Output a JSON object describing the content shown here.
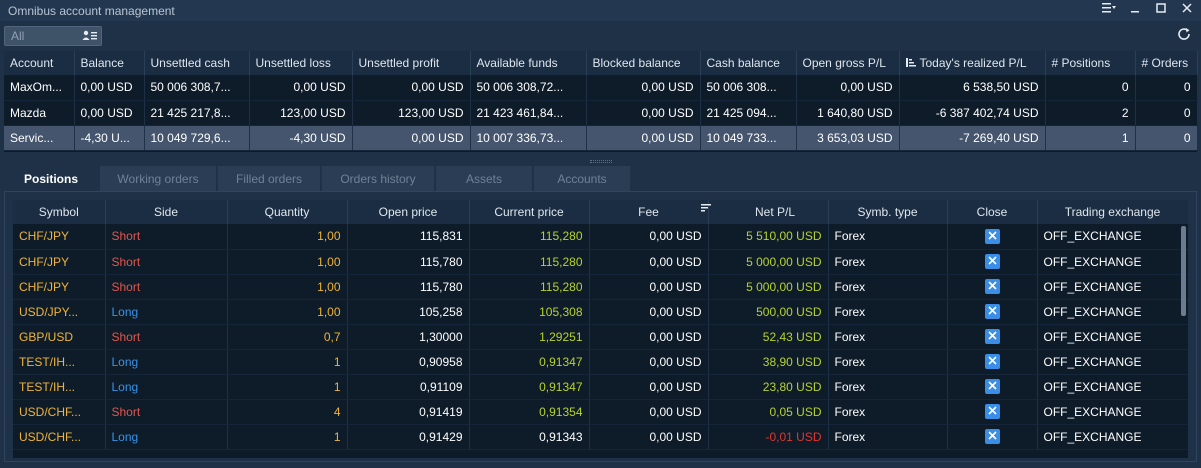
{
  "window": {
    "title": "Omnibus account management"
  },
  "toolbar": {
    "filter_placeholder": "All"
  },
  "accounts": {
    "columns": [
      "Account",
      "Balance",
      "Unsettled cash",
      "Unsettled loss",
      "Unsettled profit",
      "Available funds",
      "Blocked balance",
      "Cash balance",
      "Open gross P/L",
      "Today's realized P/L",
      "# Positions",
      "# Orders"
    ],
    "rows": [
      [
        "MaxOm...",
        "0,00 USD",
        "50 006 308,7...",
        "0,00 USD",
        "0,00 USD",
        "50 006 308,72...",
        "0,00 USD",
        "50 006 308...",
        "0,00 USD",
        "6 538,50 USD",
        "0",
        "0"
      ],
      [
        "Mazda",
        "0,00 USD",
        "21 425 217,8...",
        "123,00 USD",
        "123,00 USD",
        "21 423 461,84...",
        "0,00 USD",
        "21 425 094...",
        "1 640,80 USD",
        "-6 387 402,74 USD",
        "2",
        "0"
      ],
      [
        "Servic...",
        "-4,30 U...",
        "10 049 729,6...",
        "-4,30 USD",
        "0,00 USD",
        "10 007 336,73...",
        "0,00 USD",
        "10 049 733...",
        "3 653,03 USD",
        "-7 269,40 USD",
        "1",
        "0"
      ]
    ]
  },
  "tabs": [
    "Positions",
    "Working orders",
    "Filled orders",
    "Orders history",
    "Assets",
    "Accounts"
  ],
  "positions": {
    "columns": [
      "Symbol",
      "Side",
      "Quantity",
      "Open price",
      "Current price",
      "Fee",
      "Net P/L",
      "Symb. type",
      "Close",
      "Trading exchange"
    ],
    "rows": [
      [
        "CHF/JPY",
        "Short",
        "1,00",
        "115,831",
        "115,280",
        "0,00 USD",
        "5 510,00 USD",
        "Forex",
        "OFF_EXCHANGE"
      ],
      [
        "CHF/JPY",
        "Short",
        "1,00",
        "115,780",
        "115,280",
        "0,00 USD",
        "5 000,00 USD",
        "Forex",
        "OFF_EXCHANGE"
      ],
      [
        "CHF/JPY",
        "Short",
        "1,00",
        "115,780",
        "115,280",
        "0,00 USD",
        "5 000,00 USD",
        "Forex",
        "OFF_EXCHANGE"
      ],
      [
        "USD/JPY...",
        "Long",
        "1,00",
        "105,258",
        "105,308",
        "0,00 USD",
        "500,00 USD",
        "Forex",
        "OFF_EXCHANGE"
      ],
      [
        "GBP/USD",
        "Short",
        "0,7",
        "1,30000",
        "1,29251",
        "0,00 USD",
        "52,43 USD",
        "Forex",
        "OFF_EXCHANGE"
      ],
      [
        "TEST/IH...",
        "Long",
        "1",
        "0,90958",
        "0,91347",
        "0,00 USD",
        "38,90 USD",
        "Forex",
        "OFF_EXCHANGE"
      ],
      [
        "TEST/IH...",
        "Long",
        "1",
        "0,91109",
        "0,91347",
        "0,00 USD",
        "23,80 USD",
        "Forex",
        "OFF_EXCHANGE"
      ],
      [
        "USD/CHF...",
        "Short",
        "4",
        "0,91419",
        "0,91354",
        "0,00 USD",
        "0,05 USD",
        "Forex",
        "OFF_EXCHANGE"
      ],
      [
        "USD/CHF...",
        "Long",
        "1",
        "0,91429",
        "0,91343",
        "0,00 USD",
        "-0,01 USD",
        "Forex",
        "OFF_EXCHANGE"
      ]
    ]
  },
  "colors": {
    "background": "#1f3146",
    "symbol": "#f0b43a",
    "short": "#e4564b",
    "long": "#3a93e8",
    "positive": "#b6d32e",
    "negative": "#e4342c",
    "close_button": "#3a8ee6"
  },
  "icons": {
    "menu": "menu-icon",
    "minimize": "minimize-icon",
    "maximize": "maximize-icon",
    "close": "close-icon",
    "filter": "user-list-icon",
    "refresh": "refresh-icon",
    "sort": "sort-icon",
    "close_position": "close-position-icon"
  }
}
